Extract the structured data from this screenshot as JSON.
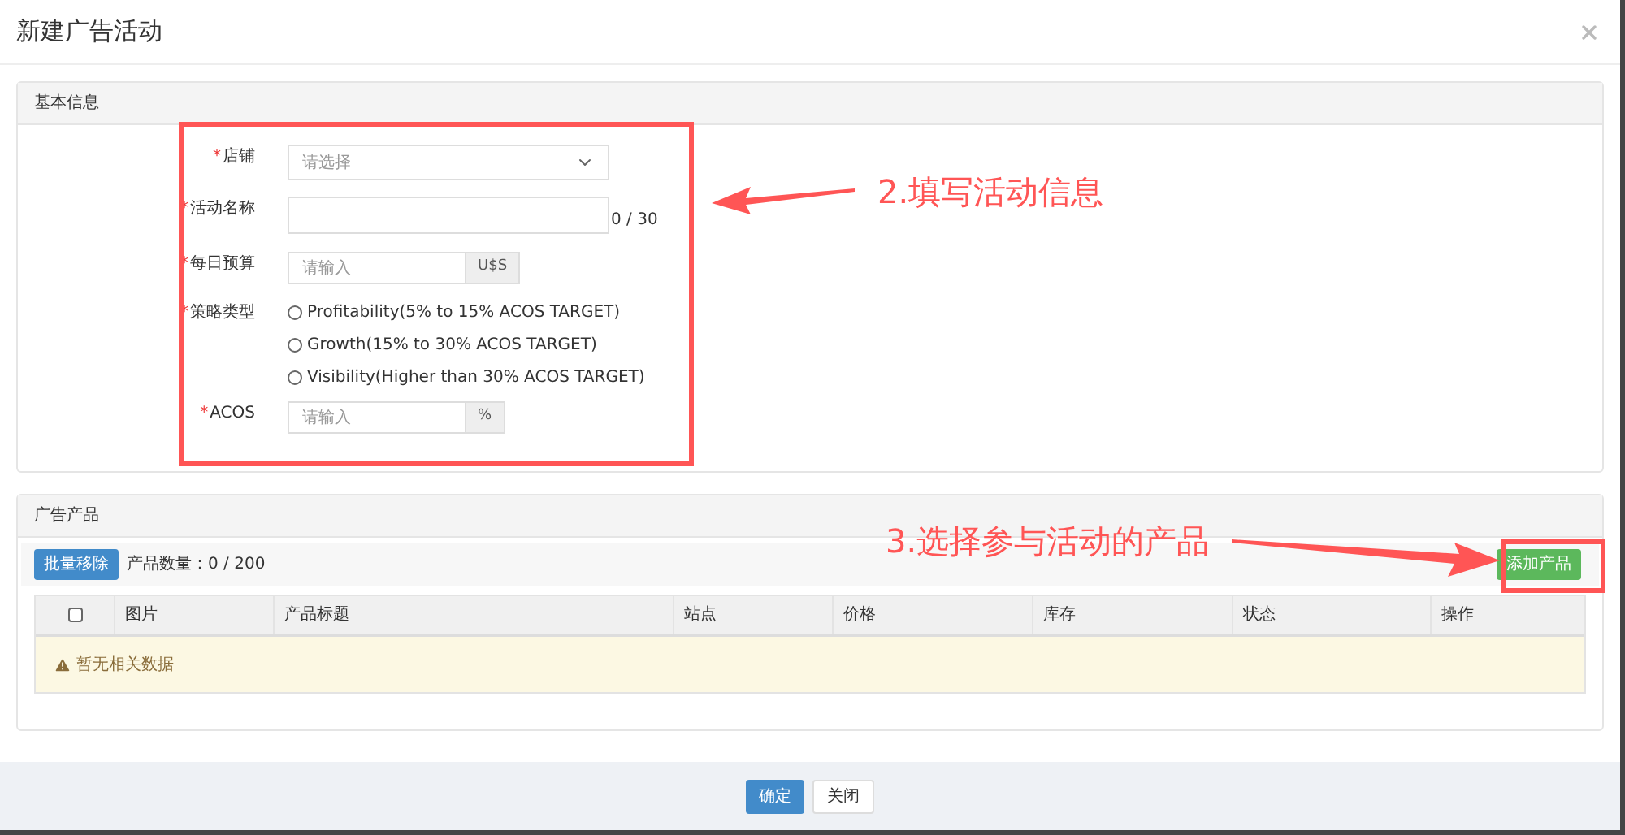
{
  "modal": {
    "title": "新建广告活动"
  },
  "basic_panel": {
    "title": "基本信息",
    "fields": [
      {
        "kind": "select",
        "required_mark": "*",
        "label": "店铺",
        "placeholder": "请选择"
      },
      {
        "kind": "text",
        "required_mark": "*",
        "label": "活动名称",
        "counter": "0 / 30"
      },
      {
        "kind": "addon",
        "required_mark": "*",
        "label": "每日预算",
        "placeholder": "请输入",
        "addon": "U$S"
      },
      {
        "kind": "radio",
        "required_mark": "*",
        "label": "策略类型",
        "options": [
          {
            "label": "Profitability(5% to 15% ACOS TARGET)",
            "selected": false
          },
          {
            "label": "Growth(15% to 30% ACOS TARGET)",
            "selected": false
          },
          {
            "label": "Visibility(Higher than 30% ACOS TARGET)",
            "selected": false
          }
        ]
      },
      {
        "kind": "addon",
        "required_mark": "*",
        "label": "ACOS",
        "placeholder": "请输入",
        "addon": "%"
      }
    ]
  },
  "products_panel": {
    "title": "广告产品",
    "remove_button": "批量移除",
    "count": "产品数量：0 / 200",
    "add_button": "添加产品",
    "table": {
      "select_all_checked": false,
      "columns": [
        "图片",
        "产品标题",
        "站点",
        "价格",
        "库存",
        "状态",
        "操作"
      ],
      "empty_message": "暂无相关数据"
    }
  },
  "footer": {
    "buttons": [
      {
        "label": "确定",
        "kind": "primary"
      },
      {
        "label": "关闭",
        "kind": "default"
      }
    ]
  },
  "annotations": [
    {
      "text": "2.填写活动信息"
    },
    {
      "text": "3.选择参与活动的产品"
    }
  ]
}
